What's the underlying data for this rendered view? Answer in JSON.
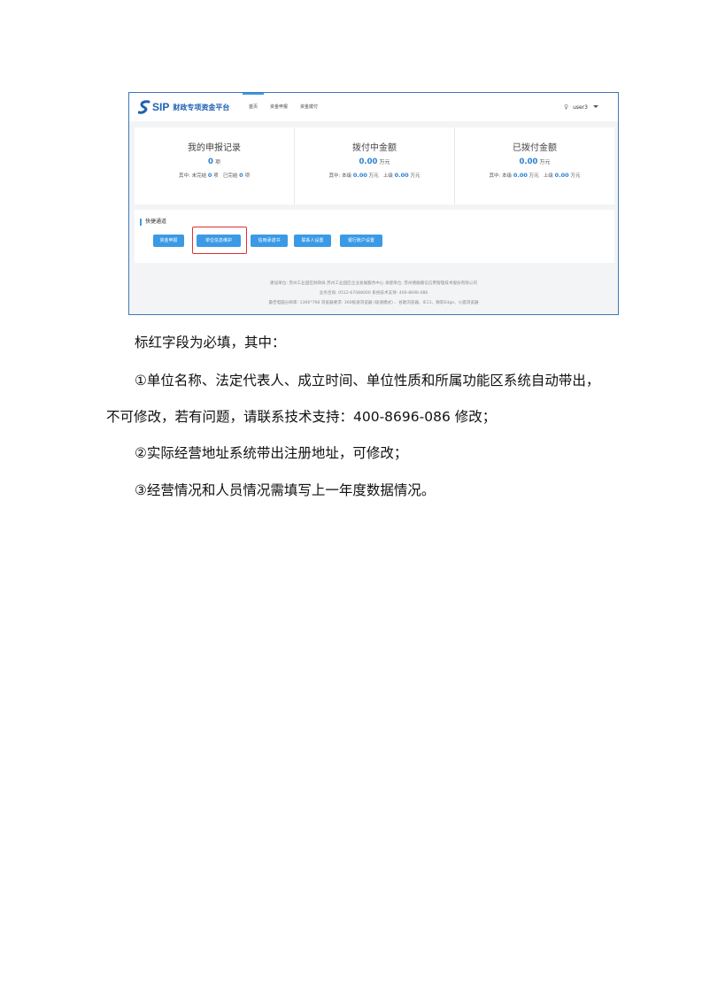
{
  "screenshot": {
    "logo": {
      "mark": "sip-logo-mark",
      "sip": "SIP",
      "title": "财政专项资金平台"
    },
    "nav": [
      "首页",
      "资金申报",
      "资金拨付"
    ],
    "user": {
      "icon": "user-icon",
      "name": "user3"
    },
    "stats": [
      {
        "title": "我的申报记录",
        "value": "0",
        "unit": "项",
        "detail": [
          {
            "label": "其中: 未完结 ",
            "value": "0",
            "unit": " 项"
          },
          {
            "label": "   已完结 ",
            "value": "0",
            "unit": " 项"
          }
        ]
      },
      {
        "title": "拨付中金额",
        "value": "0.00",
        "unit": "万元",
        "detail": [
          {
            "label": "其中: 本级 ",
            "value": "0.00",
            "unit": " 万元"
          },
          {
            "label": "   上级 ",
            "value": "0.00",
            "unit": " 万元"
          }
        ]
      },
      {
        "title": "已拨付金额",
        "value": "0.00",
        "unit": "万元",
        "detail": [
          {
            "label": "其中: 本级 ",
            "value": "0.00",
            "unit": " 万元"
          },
          {
            "label": "   上级 ",
            "value": "0.00",
            "unit": " 万元"
          }
        ]
      }
    ],
    "quick": {
      "title": "快捷通道",
      "buttons": [
        "资金申报",
        "单位信息维护",
        "信用承诺书",
        "联系人设置",
        "银行账户设置"
      ]
    },
    "footer": [
      "建设单位: 苏州工业园区财政局 苏州工业园区企业发展服务中心    承建单位: 苏州德融嘉信信用管理技术股份有限公司",
      "业务咨询: 0512-67088000    系统技术支持: 400-8696-086",
      "最佳电脑分辨率: 1366*768   浏览器要求: 360极速浏览器 (极速模式) 、谷歌浏览器、IE11、微软Edge、火狐浏览器"
    ],
    "colors": {
      "accent": "#3a9ae6",
      "highlight": "#e03131",
      "logo": "#1d62b3"
    }
  },
  "doc": {
    "line1": "标红字段为必填，其中：",
    "line2": "①单位名称、法定代表人、成立时间、单位性质和所属功能区系统自动带出，",
    "line3": "不可修改，若有问题，请联系技术支持：400-8696-086 修改；",
    "line4": "②实际经营地址系统带出注册地址，可修改；",
    "line5": "③经营情况和人员情况需填写上一年度数据情况。"
  }
}
